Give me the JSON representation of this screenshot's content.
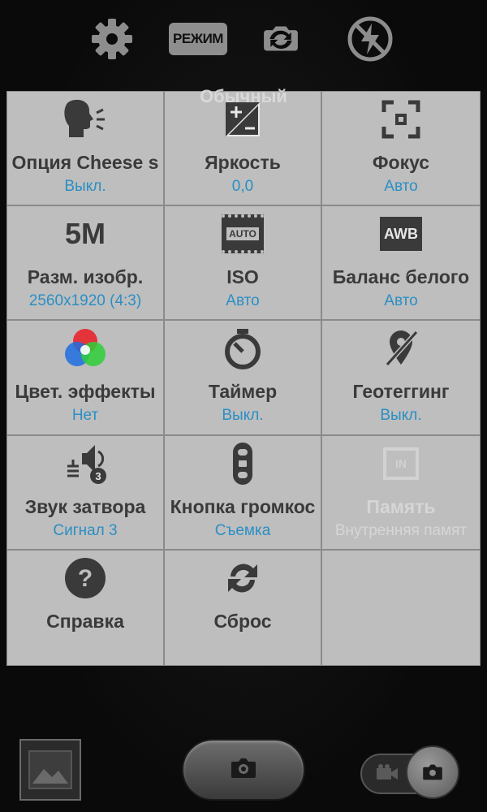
{
  "topbar": {
    "icons": [
      "gear-icon",
      "mode-icon",
      "switch-camera-icon",
      "flash-off-icon"
    ],
    "mode_badge": "РЕЖИМ",
    "mode_label": "Обычный"
  },
  "settings": [
    {
      "title": "Опция Cheese s",
      "value": "Выкл.",
      "icon": "voice-command-icon"
    },
    {
      "title": "Яркость",
      "value": "0,0",
      "icon": "exposure-icon"
    },
    {
      "title": "Фокус",
      "value": "Авто",
      "icon": "focus-icon"
    },
    {
      "title": "Разм. изобр.",
      "value": "2560x1920 (4:3)",
      "icon": "resolution-5m-icon",
      "icon_text": "5M"
    },
    {
      "title": "ISO",
      "value": "Авто",
      "icon": "iso-auto-icon",
      "icon_text": "AUTO"
    },
    {
      "title": "Баланс белого",
      "value": "Авто",
      "icon": "awb-icon",
      "icon_text": "AWB"
    },
    {
      "title": "Цвет. эффекты",
      "value": "Нет",
      "icon": "color-effects-icon"
    },
    {
      "title": "Таймер",
      "value": "Выкл.",
      "icon": "timer-icon"
    },
    {
      "title": "Геотеггинг",
      "value": "Выкл.",
      "icon": "geotag-off-icon"
    },
    {
      "title": "Звук затвора",
      "value": "Сигнал 3",
      "icon": "shutter-sound-icon",
      "icon_text": "3"
    },
    {
      "title": "Кнопка громкос",
      "value": "Съемка",
      "icon": "volume-key-icon"
    },
    {
      "title": "Память",
      "value": "Внутренняя памят",
      "icon": "storage-icon",
      "icon_text": "IN",
      "disabled": true
    },
    {
      "title": "Справка",
      "value": "",
      "icon": "help-icon"
    },
    {
      "title": "Сброс",
      "value": "",
      "icon": "reset-icon"
    },
    {
      "title": "",
      "value": "",
      "icon": ""
    }
  ],
  "bottombar": {
    "icons": [
      "gallery-thumbnail-icon",
      "shutter-camera-icon",
      "video-icon",
      "camera-mode-icon"
    ]
  },
  "colors": {
    "accent": "#2a8fc4",
    "panel": "#bebebe",
    "title": "#3a3a3a"
  }
}
